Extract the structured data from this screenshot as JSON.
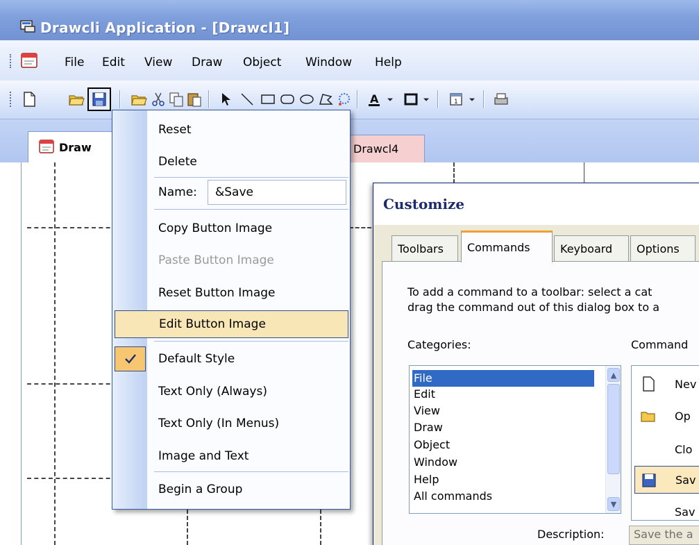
{
  "window": {
    "title": "Drawcli Application - [Drawcl1]"
  },
  "menubar": {
    "items": [
      {
        "label": "File"
      },
      {
        "label": "Edit"
      },
      {
        "label": "View"
      },
      {
        "label": "Draw"
      },
      {
        "label": "Object"
      },
      {
        "label": "Window"
      },
      {
        "label": "Help"
      }
    ]
  },
  "toolbar": {
    "buttons": [
      "new-document-icon",
      "open-folder-icon",
      "save-disk-icon",
      "open-folder-icon",
      "cut-scissors-icon",
      "copy-icon",
      "paste-icon",
      "select-arrow-icon",
      "line-icon",
      "rectangle-icon",
      "rounded-rectangle-icon",
      "ellipse-icon",
      "polygon-icon",
      "lasso-icon",
      "font-color-icon",
      "border-icon",
      "object-properties-icon",
      "print-icon"
    ]
  },
  "tabs": {
    "active_label": "Draw",
    "other_label": "Drawcl4"
  },
  "context_menu": {
    "reset": "Reset",
    "delete": "Delete",
    "name_label": "Name:",
    "name_value": "&Save",
    "copy_image": "Copy Button Image",
    "paste_image": "Paste Button Image",
    "reset_image": "Reset Button Image",
    "edit_image": "Edit Button Image",
    "default_style": "Default Style",
    "text_only_always": "Text Only (Always)",
    "text_only_menus": "Text Only (In Menus)",
    "image_and_text": "Image and Text",
    "begin_group": "Begin a Group"
  },
  "customize_dialog": {
    "title": "Customize",
    "tabs": [
      "Toolbars",
      "Commands",
      "Keyboard",
      "Options"
    ],
    "active_tab": "Commands",
    "instructions_line1": "To add a command to a toolbar: select a cat",
    "instructions_line2": "drag the command out of this dialog box to a",
    "categories_label": "Categories:",
    "commands_label": "Command",
    "categories": [
      "File",
      "Edit",
      "View",
      "Draw",
      "Object",
      "Window",
      "Help",
      "All commands"
    ],
    "selected_category": "File",
    "commands": [
      "Nev",
      "Op",
      "Clo",
      "Sav",
      "Sav"
    ],
    "description_label": "Description:",
    "description_value": "Save the a"
  },
  "colors": {
    "title_gradient_top": "#9db9eb",
    "menu_highlight": "#f9e6b6",
    "list_selection": "#316ac5",
    "tab_accent": "#f0a030"
  }
}
